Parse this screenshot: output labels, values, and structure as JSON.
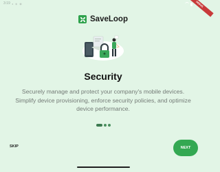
{
  "status_bar": {
    "time": "3:19",
    "icons": "◂ ◈ ◉",
    "debug_banner": "DEBUG"
  },
  "brand": {
    "name": "SaveLoop",
    "logo_icon": "loop-logo-icon",
    "accent": "#2ea24c"
  },
  "illustration": {
    "icon": "security-illustration-icon"
  },
  "onboarding": {
    "title": "Security",
    "description_lines": [
      "Securely manage and protect your company's mobile devices.",
      "Simplify device provisioning, enforce security policies, and optimize",
      "device performance."
    ],
    "page_indicator": {
      "current": 1,
      "total": 3
    }
  },
  "actions": {
    "skip_label": "SKIP",
    "next_label": "NEXT",
    "next_color": "#33a852"
  },
  "colors": {
    "background": "#e2f5e6",
    "text_primary": "#111111",
    "text_secondary": "#737a76"
  }
}
